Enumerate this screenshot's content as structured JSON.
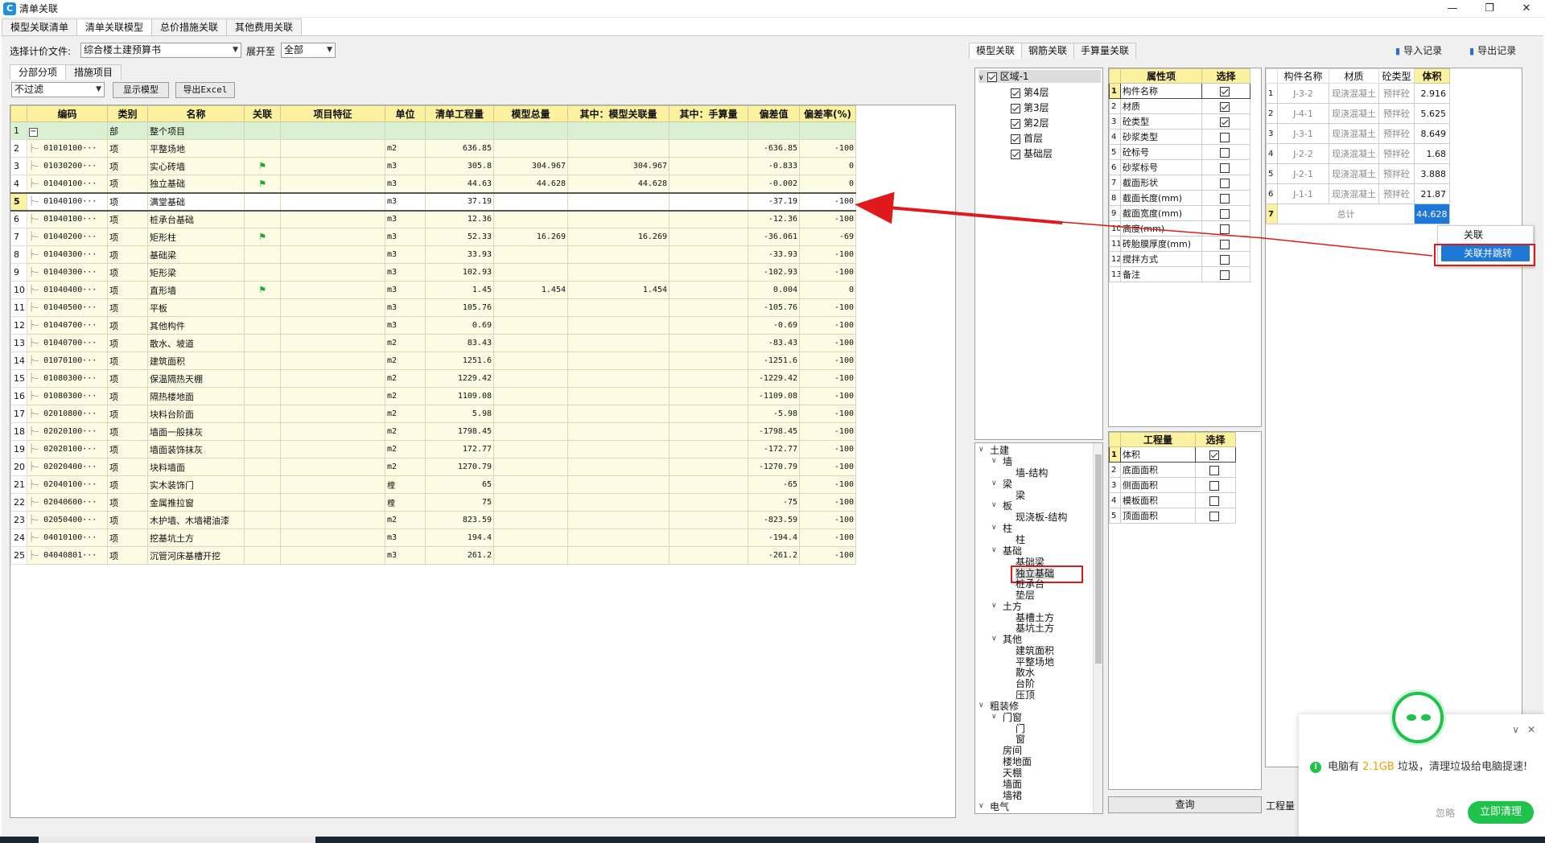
{
  "window": {
    "title": "清单关联",
    "app_icon": "C"
  },
  "top_tabs": [
    "模型关联清单",
    "清单关联模型",
    "总价措施关联",
    "其他费用关联"
  ],
  "toolbar": {
    "file_label": "选择计价文件:",
    "file_value": "综合楼土建预算书",
    "expand_label": "展开至",
    "expand_value": "全部"
  },
  "sub_tabs": [
    "分部分项",
    "措施项目"
  ],
  "filter": {
    "value": "不过滤",
    "show_model": "显示模型",
    "export_excel": "导出Excel"
  },
  "grid": {
    "headers": [
      "编码",
      "类别",
      "名称",
      "关联",
      "项目特征",
      "单位",
      "清单工程量",
      "模型总量",
      "其中：模型关联量",
      "其中：手算量",
      "偏差值",
      "偏差率(%)"
    ],
    "root": {
      "n": "1",
      "type": "部",
      "name": "整个项目"
    },
    "rows": [
      {
        "n": "2",
        "code": "01010100···",
        "type": "项",
        "name": "平整场地",
        "flag": false,
        "unit": "m2",
        "qty": "636.85",
        "model": "",
        "rel": "",
        "hand": "",
        "dev": "-636.85",
        "rate": "-100"
      },
      {
        "n": "3",
        "code": "01030200···",
        "type": "项",
        "name": "实心砖墙",
        "flag": true,
        "unit": "m3",
        "qty": "305.8",
        "model": "304.967",
        "rel": "304.967",
        "hand": "",
        "dev": "-0.833",
        "rate": "0"
      },
      {
        "n": "4",
        "code": "01040100···",
        "type": "项",
        "name": "独立基础",
        "flag": true,
        "unit": "m3",
        "qty": "44.63",
        "model": "44.628",
        "rel": "44.628",
        "hand": "",
        "dev": "-0.002",
        "rate": "0"
      },
      {
        "n": "5",
        "code": "01040100···",
        "type": "项",
        "name": "满堂基础",
        "flag": false,
        "unit": "m3",
        "qty": "37.19",
        "model": "",
        "rel": "",
        "hand": "",
        "dev": "-37.19",
        "rate": "-100",
        "sel": true
      },
      {
        "n": "6",
        "code": "01040100···",
        "type": "项",
        "name": "桩承台基础",
        "flag": false,
        "unit": "m3",
        "qty": "12.36",
        "model": "",
        "rel": "",
        "hand": "",
        "dev": "-12.36",
        "rate": "-100"
      },
      {
        "n": "7",
        "code": "01040200···",
        "type": "项",
        "name": "矩形柱",
        "flag": true,
        "unit": "m3",
        "qty": "52.33",
        "model": "16.269",
        "rel": "16.269",
        "hand": "",
        "dev": "-36.061",
        "rate": "-69"
      },
      {
        "n": "8",
        "code": "01040300···",
        "type": "项",
        "name": "基础梁",
        "flag": false,
        "unit": "m3",
        "qty": "33.93",
        "model": "",
        "rel": "",
        "hand": "",
        "dev": "-33.93",
        "rate": "-100"
      },
      {
        "n": "9",
        "code": "01040300···",
        "type": "项",
        "name": "矩形梁",
        "flag": false,
        "unit": "m3",
        "qty": "102.93",
        "model": "",
        "rel": "",
        "hand": "",
        "dev": "-102.93",
        "rate": "-100"
      },
      {
        "n": "10",
        "code": "01040400···",
        "type": "项",
        "name": "直形墙",
        "flag": true,
        "unit": "m3",
        "qty": "1.45",
        "model": "1.454",
        "rel": "1.454",
        "hand": "",
        "dev": "0.004",
        "rate": "0"
      },
      {
        "n": "11",
        "code": "01040500···",
        "type": "项",
        "name": "平板",
        "flag": false,
        "unit": "m3",
        "qty": "105.76",
        "model": "",
        "rel": "",
        "hand": "",
        "dev": "-105.76",
        "rate": "-100"
      },
      {
        "n": "12",
        "code": "01040700···",
        "type": "项",
        "name": "其他构件",
        "flag": false,
        "unit": "m3",
        "qty": "0.69",
        "model": "",
        "rel": "",
        "hand": "",
        "dev": "-0.69",
        "rate": "-100"
      },
      {
        "n": "13",
        "code": "01040700···",
        "type": "项",
        "name": "散水、坡道",
        "flag": false,
        "unit": "m2",
        "qty": "83.43",
        "model": "",
        "rel": "",
        "hand": "",
        "dev": "-83.43",
        "rate": "-100"
      },
      {
        "n": "14",
        "code": "01070100···",
        "type": "项",
        "name": "建筑面积",
        "flag": false,
        "unit": "m2",
        "qty": "1251.6",
        "model": "",
        "rel": "",
        "hand": "",
        "dev": "-1251.6",
        "rate": "-100"
      },
      {
        "n": "15",
        "code": "01080300···",
        "type": "项",
        "name": "保温隔热天棚",
        "flag": false,
        "unit": "m2",
        "qty": "1229.42",
        "model": "",
        "rel": "",
        "hand": "",
        "dev": "-1229.42",
        "rate": "-100"
      },
      {
        "n": "16",
        "code": "01080300···",
        "type": "项",
        "name": "隔热楼地面",
        "flag": false,
        "unit": "m2",
        "qty": "1109.08",
        "model": "",
        "rel": "",
        "hand": "",
        "dev": "-1109.08",
        "rate": "-100"
      },
      {
        "n": "17",
        "code": "02010800···",
        "type": "项",
        "name": "块料台阶面",
        "flag": false,
        "unit": "m2",
        "qty": "5.98",
        "model": "",
        "rel": "",
        "hand": "",
        "dev": "-5.98",
        "rate": "-100"
      },
      {
        "n": "18",
        "code": "02020100···",
        "type": "项",
        "name": "墙面一般抹灰",
        "flag": false,
        "unit": "m2",
        "qty": "1798.45",
        "model": "",
        "rel": "",
        "hand": "",
        "dev": "-1798.45",
        "rate": "-100"
      },
      {
        "n": "19",
        "code": "02020100···",
        "type": "项",
        "name": "墙面装饰抹灰",
        "flag": false,
        "unit": "m2",
        "qty": "172.77",
        "model": "",
        "rel": "",
        "hand": "",
        "dev": "-172.77",
        "rate": "-100"
      },
      {
        "n": "20",
        "code": "02020400···",
        "type": "项",
        "name": "块料墙面",
        "flag": false,
        "unit": "m2",
        "qty": "1270.79",
        "model": "",
        "rel": "",
        "hand": "",
        "dev": "-1270.79",
        "rate": "-100"
      },
      {
        "n": "21",
        "code": "02040100···",
        "type": "项",
        "name": "实木装饰门",
        "flag": false,
        "unit": "樘",
        "qty": "65",
        "model": "",
        "rel": "",
        "hand": "",
        "dev": "-65",
        "rate": "-100"
      },
      {
        "n": "22",
        "code": "02040600···",
        "type": "项",
        "name": "金属推拉窗",
        "flag": false,
        "unit": "樘",
        "qty": "75",
        "model": "",
        "rel": "",
        "hand": "",
        "dev": "-75",
        "rate": "-100"
      },
      {
        "n": "23",
        "code": "02050400···",
        "type": "项",
        "name": "木护墙、木墙裙油漆",
        "flag": false,
        "unit": "m2",
        "qty": "823.59",
        "model": "",
        "rel": "",
        "hand": "",
        "dev": "-823.59",
        "rate": "-100"
      },
      {
        "n": "24",
        "code": "04010100···",
        "type": "项",
        "name": "挖基坑土方",
        "flag": false,
        "unit": "m3",
        "qty": "194.4",
        "model": "",
        "rel": "",
        "hand": "",
        "dev": "-194.4",
        "rate": "-100"
      },
      {
        "n": "25",
        "code": "04040801···",
        "type": "项",
        "name": "沉管河床基槽开挖",
        "flag": false,
        "unit": "m3",
        "qty": "261.2",
        "model": "",
        "rel": "",
        "hand": "",
        "dev": "-261.2",
        "rate": "-100"
      }
    ]
  },
  "right_tabs": [
    "模型关联",
    "钢筋关联",
    "手算量关联"
  ],
  "import_record": "导入记录",
  "export_record": "导出记录",
  "floor_tree": {
    "root": "区域-1",
    "floors": [
      "第4层",
      "第3层",
      "第2层",
      "首层",
      "基础层"
    ]
  },
  "attr_table": {
    "headers": [
      "属性项",
      "选择"
    ],
    "rows": [
      {
        "n": "1",
        "name": "构件名称",
        "on": true
      },
      {
        "n": "2",
        "name": "材质",
        "on": true
      },
      {
        "n": "3",
        "name": "砼类型",
        "on": true
      },
      {
        "n": "4",
        "name": "砂浆类型",
        "on": false
      },
      {
        "n": "5",
        "name": "砼标号",
        "on": false
      },
      {
        "n": "6",
        "name": "砂浆标号",
        "on": false
      },
      {
        "n": "7",
        "name": "截面形状",
        "on": false
      },
      {
        "n": "8",
        "name": "截面长度(mm)",
        "on": false
      },
      {
        "n": "9",
        "name": "截面宽度(mm)",
        "on": false
      },
      {
        "n": "10",
        "name": "高度(mm)",
        "on": false
      },
      {
        "n": "11",
        "name": "砖胎膜厚度(mm)",
        "on": false
      },
      {
        "n": "12",
        "name": "搅拌方式",
        "on": false
      },
      {
        "n": "13",
        "name": "备注",
        "on": false
      }
    ]
  },
  "comp_table": {
    "headers": [
      "构件名称",
      "材质",
      "砼类型",
      "体积"
    ],
    "rows": [
      {
        "n": "1",
        "name": "J-3-2",
        "mat": "现浇混凝土",
        "type": "预拌砼",
        "vol": "2.916"
      },
      {
        "n": "2",
        "name": "J-4-1",
        "mat": "现浇混凝土",
        "type": "预拌砼",
        "vol": "5.625"
      },
      {
        "n": "3",
        "name": "J-3-1",
        "mat": "现浇混凝土",
        "type": "预拌砼",
        "vol": "8.649"
      },
      {
        "n": "4",
        "name": "J-2-2",
        "mat": "现浇混凝土",
        "type": "预拌砼",
        "vol": "1.68"
      },
      {
        "n": "5",
        "name": "J-2-1",
        "mat": "现浇混凝土",
        "type": "预拌砼",
        "vol": "3.888"
      },
      {
        "n": "6",
        "name": "J-1-1",
        "mat": "现浇混凝土",
        "type": "预拌砼",
        "vol": "21.87"
      }
    ],
    "total": {
      "n": "7",
      "label": "总计",
      "vol": "44.628"
    }
  },
  "context_menu": {
    "link": "关联",
    "link_jump": "关联并跳转"
  },
  "category_tree": [
    {
      "label": "土建",
      "lvl": 0,
      "chev": true
    },
    {
      "label": "墙",
      "lvl": 1,
      "chev": true
    },
    {
      "label": "墙-结构",
      "lvl": 3
    },
    {
      "label": "梁",
      "lvl": 1,
      "chev": true
    },
    {
      "label": "梁",
      "lvl": 3
    },
    {
      "label": "板",
      "lvl": 1,
      "chev": true
    },
    {
      "label": "现浇板-结构",
      "lvl": 3
    },
    {
      "label": "柱",
      "lvl": 1,
      "chev": true
    },
    {
      "label": "柱",
      "lvl": 3
    },
    {
      "label": "基础",
      "lvl": 1,
      "chev": true
    },
    {
      "label": "基础梁",
      "lvl": 3
    },
    {
      "label": "独立基础",
      "lvl": 3,
      "boxed": true
    },
    {
      "label": "桩承台",
      "lvl": 3
    },
    {
      "label": "垫层",
      "lvl": 3
    },
    {
      "label": "土方",
      "lvl": 1,
      "chev": true
    },
    {
      "label": "基槽土方",
      "lvl": 3
    },
    {
      "label": "基坑土方",
      "lvl": 3
    },
    {
      "label": "其他",
      "lvl": 1,
      "chev": true
    },
    {
      "label": "建筑面积",
      "lvl": 3
    },
    {
      "label": "平整场地",
      "lvl": 3
    },
    {
      "label": "散水",
      "lvl": 3
    },
    {
      "label": "台阶",
      "lvl": 3
    },
    {
      "label": "压顶",
      "lvl": 3
    },
    {
      "label": "粗装修",
      "lvl": 0,
      "chev": true
    },
    {
      "label": "门窗",
      "lvl": 1,
      "chev": true
    },
    {
      "label": "门",
      "lvl": 2
    },
    {
      "label": "窗",
      "lvl": 2
    },
    {
      "label": "房间",
      "lvl": 1
    },
    {
      "label": "楼地面",
      "lvl": 1
    },
    {
      "label": "天棚",
      "lvl": 1
    },
    {
      "label": "墙面",
      "lvl": 1
    },
    {
      "label": "墙裙",
      "lvl": 1
    },
    {
      "label": "电气",
      "lvl": 0,
      "chev": true
    }
  ],
  "qty_table": {
    "headers": [
      "工程量",
      "选择"
    ],
    "rows": [
      {
        "n": "1",
        "name": "体积",
        "on": true
      },
      {
        "n": "2",
        "name": "底面面积",
        "on": false
      },
      {
        "n": "3",
        "name": "侧面面积",
        "on": false
      },
      {
        "n": "4",
        "name": "模板面积",
        "on": false
      },
      {
        "n": "5",
        "name": "顶面面积",
        "on": false
      }
    ]
  },
  "query_button": "查询",
  "qty_label": "工程量",
  "toast": {
    "msg_a": "电脑有 ",
    "size": "2.1GB",
    "msg_b": " 垃圾，清理垃圾给电脑提速!",
    "ignore": "忽略",
    "clean": "立即清理"
  }
}
